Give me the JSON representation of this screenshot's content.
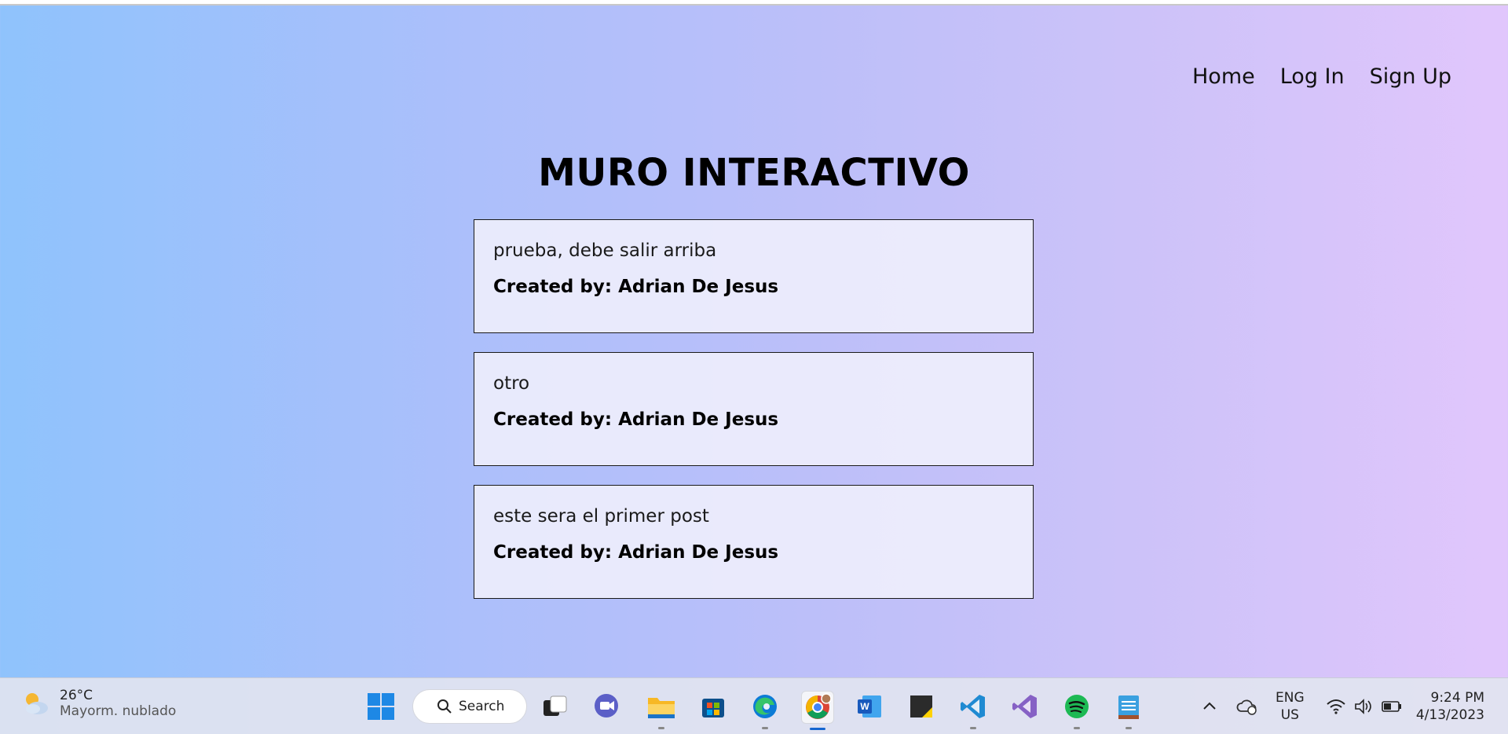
{
  "nav": {
    "home": "Home",
    "login": "Log In",
    "signup": "Sign Up"
  },
  "page_title": "MURO INTERACTIVO",
  "posts": [
    {
      "text": "prueba, debe salir arriba",
      "author": "Created by: Adrian De Jesus"
    },
    {
      "text": "otro",
      "author": "Created by: Adrian De Jesus"
    },
    {
      "text": "este sera el primer post",
      "author": "Created by: Adrian De Jesus"
    }
  ],
  "taskbar": {
    "weather": {
      "temp": "26°C",
      "condition": "Mayorm. nublado",
      "icon": "partly-cloudy-icon"
    },
    "search_label": "Search",
    "apps": [
      "windows-start-icon",
      "task-view-icon",
      "teams-chat-icon",
      "file-explorer-icon",
      "microsoft-store-icon",
      "edge-icon",
      "chrome-icon",
      "word-icon",
      "sticky-notes-icon",
      "vscode-icon",
      "visual-studio-icon",
      "spotify-icon",
      "notepad-icon"
    ],
    "lang_line1": "ENG",
    "lang_line2": "US",
    "time": "9:24 PM",
    "date": "4/13/2023"
  },
  "colors": {
    "gradient_start": "#8fc3fc",
    "gradient_end": "#e1c6fc",
    "post_border": "#1a1a1a"
  }
}
